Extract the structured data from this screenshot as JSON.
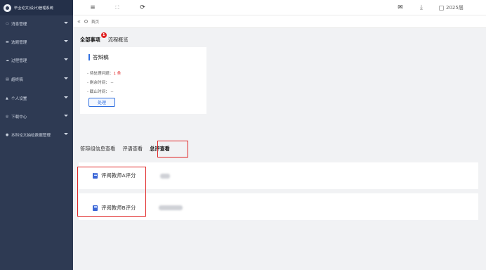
{
  "sidebar": {
    "title": "毕业论文(设计)管理系统",
    "items": [
      {
        "icon": "▭",
        "label": "消息管理"
      },
      {
        "icon": "▬",
        "label": "选题管理"
      },
      {
        "icon": "☁",
        "label": "过程管理"
      },
      {
        "icon": "▤",
        "label": "超终稿"
      },
      {
        "icon": "▲",
        "label": "个人设置"
      },
      {
        "icon": "◎",
        "label": "下载中心"
      },
      {
        "icon": "●",
        "label": "本科论文抽检数据管理"
      }
    ]
  },
  "topbar": {
    "menu_icon": "≡",
    "fullscreen_icon": "⛶",
    "refresh_icon": "⟳",
    "mail_icon": "✉",
    "download_icon": "⤓",
    "year": "2025届"
  },
  "breadcrumb": {
    "collapse": "«",
    "home": "首页"
  },
  "tabs": {
    "all": "全部事项",
    "badge": "1",
    "overview": "流程概览"
  },
  "task_card": {
    "title": "答辩稿",
    "pending_prefix": "- 待处理问题：",
    "pending_value": "1 条",
    "remaining": "- 剩余时间： --",
    "deadline": "- 截止时间： --",
    "button": "处理"
  },
  "sub_tabs": [
    {
      "label": "答辩组信息查看"
    },
    {
      "label": "评语查看"
    },
    {
      "label": "总评查看"
    }
  ],
  "rows": [
    {
      "label": "评阅教师A评分"
    },
    {
      "label": "评阅教师B评分"
    }
  ],
  "colors": {
    "sidebar_bg": "#2e3a53",
    "accent": "#2f6fe0",
    "highlight": "#e02424"
  }
}
